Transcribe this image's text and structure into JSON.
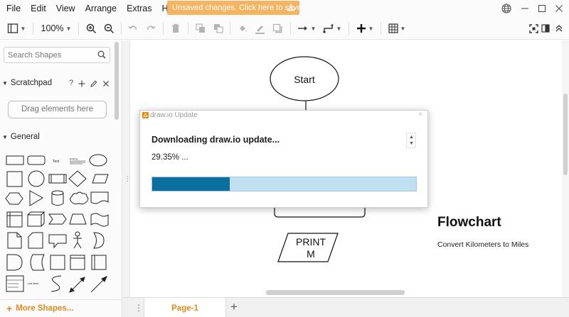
{
  "menubar": {
    "items": [
      "File",
      "Edit",
      "View",
      "Arrange",
      "Extras",
      "Help"
    ],
    "unsaved_notice": "Unsaved changes. Click here to save."
  },
  "toolbar": {
    "zoom": "100%"
  },
  "sidebar": {
    "search_placeholder": "Search Shapes",
    "scratchpad": {
      "title": "Scratchpad",
      "help": "?",
      "drag_hint": "Drag elements here"
    },
    "general": {
      "title": "General",
      "text_shape_label": "Text",
      "heading_shape_label": "Heading",
      "list_item_label": "List Item"
    },
    "more_shapes": "More Shapes..."
  },
  "canvas": {
    "start_label": "Start",
    "print_label_line1": "PRINT",
    "print_label_line2": "M",
    "title": "Flowchart",
    "subtitle": "Convert Kilometers to Miles"
  },
  "pages": {
    "tabs": [
      {
        "label": "Page-1",
        "active": true
      }
    ]
  },
  "dialog": {
    "title": "draw.io Update",
    "heading": "Downloading draw.io update...",
    "percent_text": "29.35% ...",
    "progress": 29.35
  },
  "colors": {
    "accent_orange": "#e08a1e",
    "unsaved_bg": "#f4b461",
    "progress_fill": "#0d6f9e",
    "progress_track": "#bfe0f1"
  }
}
